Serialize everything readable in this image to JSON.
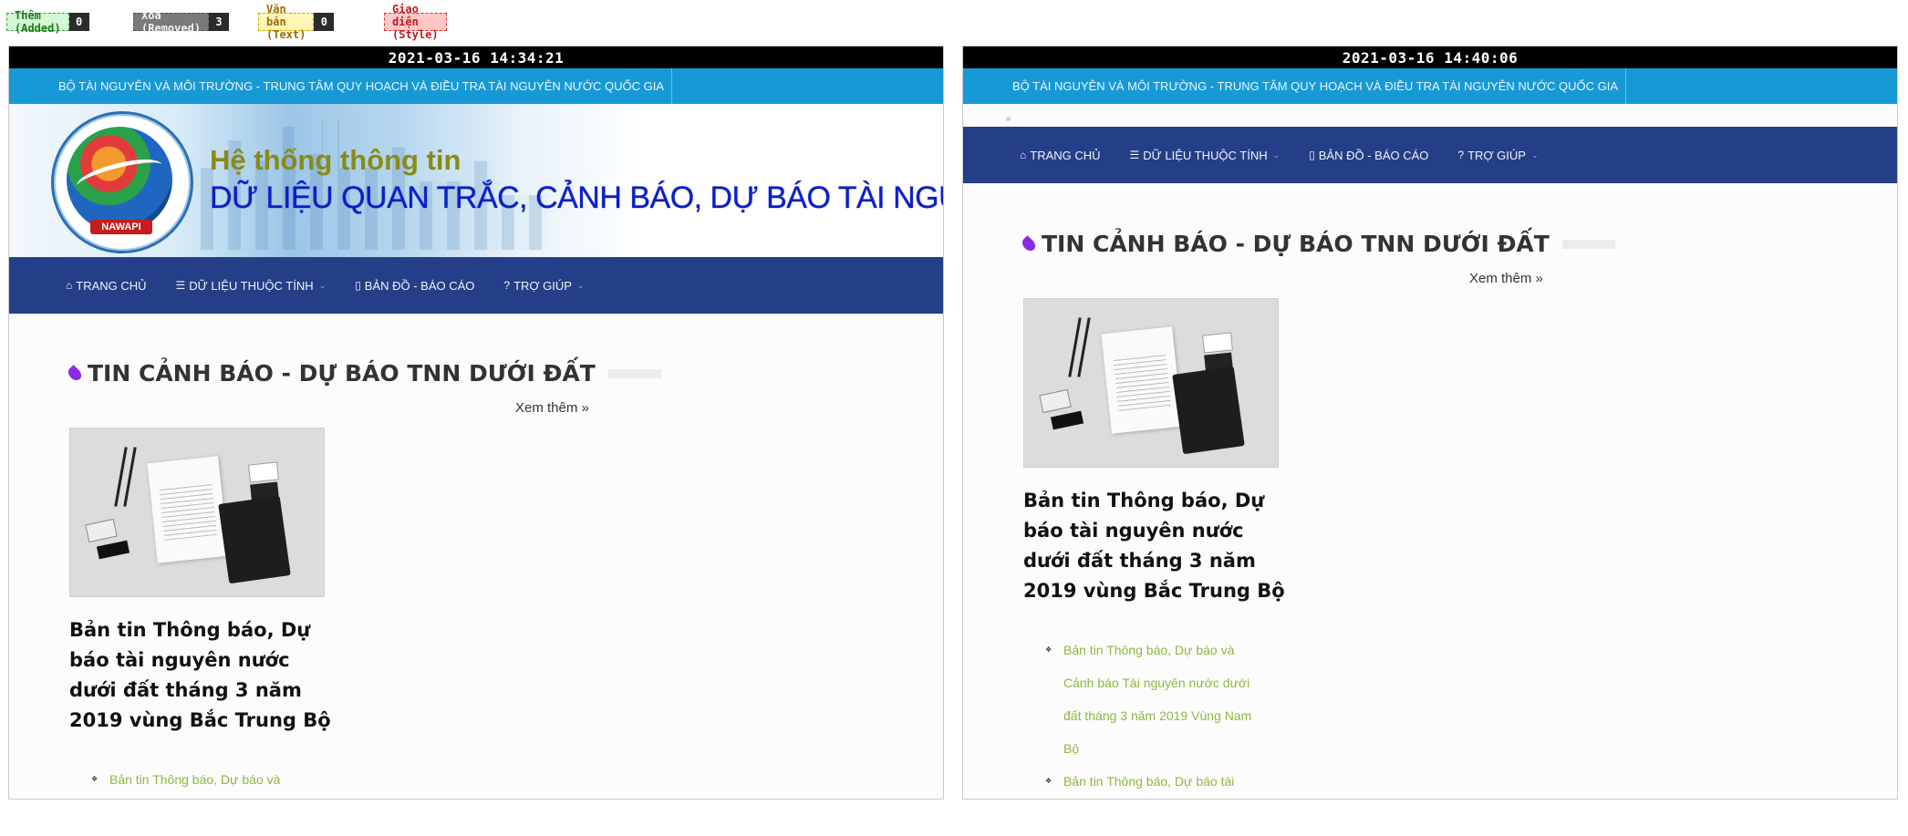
{
  "legend": {
    "added": {
      "label": "Thêm (Added)",
      "count": "0",
      "color": "#d4f7d4"
    },
    "removed": {
      "label": "Xoá (Removed)",
      "count": "3",
      "color": "#7a7a7a"
    },
    "text": {
      "label": "Văn bản (Text)",
      "count": "0",
      "color": "#fff6b8"
    },
    "style": {
      "label": "Giao diện (Style)",
      "color": "#ffc8c8"
    }
  },
  "site": {
    "ministry_bar": "BỘ TÀI NGUYÊN VÀ MÔI TRƯỜNG - TRUNG TÂM QUY HOẠCH VÀ ĐIỀU TRA TÀI NGUYÊN NƯỚC QUỐC GIA",
    "banner": {
      "line1": "Hệ thống thông tin",
      "line2": "DỮ LIỆU QUAN TRẮC, CẢNH BÁO, DỰ BÁO TÀI NGUY",
      "logo_tag": "NAWAPI"
    },
    "nav": [
      {
        "label": "TRANG CHỦ",
        "icon": "home-icon",
        "has_dropdown": false
      },
      {
        "label": "DỮ LIỆU THUỘC TÍNH",
        "icon": "database-icon",
        "has_dropdown": true
      },
      {
        "label": "BẢN ĐỒ - BÁO CÁO",
        "icon": "map-icon",
        "has_dropdown": false
      },
      {
        "label": "TRỢ GIÚP",
        "icon": "question-circle-icon",
        "has_dropdown": true
      }
    ],
    "section_title": "TIN CẢNH BÁO - DỰ BÁO TNN DƯỚI ĐẤT",
    "more_link": "Xem thêm »",
    "post_title": "Bản tin Thông báo, Dự báo tài nguyên nước dưới đất tháng 3 năm 2019 vùng Bắc Trung Bộ"
  },
  "left": {
    "timestamp": "2021-03-16 14:34:21",
    "links": [
      "Bản tin Thông báo, Dự báo và"
    ]
  },
  "right": {
    "timestamp": "2021-03-16 14:40:06",
    "links": [
      "Bản tin Thông báo, Dự báo và Cảnh báo Tài nguyên nước dưới đất tháng 3 năm 2019 Vùng Nam Bộ",
      "Bản tin Thông báo, Dự báo tài"
    ]
  },
  "colors": {
    "topbar": "#1799d6",
    "nav": "#243f87",
    "link": "#8fb73e",
    "drop_icon": "#8a2be2"
  }
}
